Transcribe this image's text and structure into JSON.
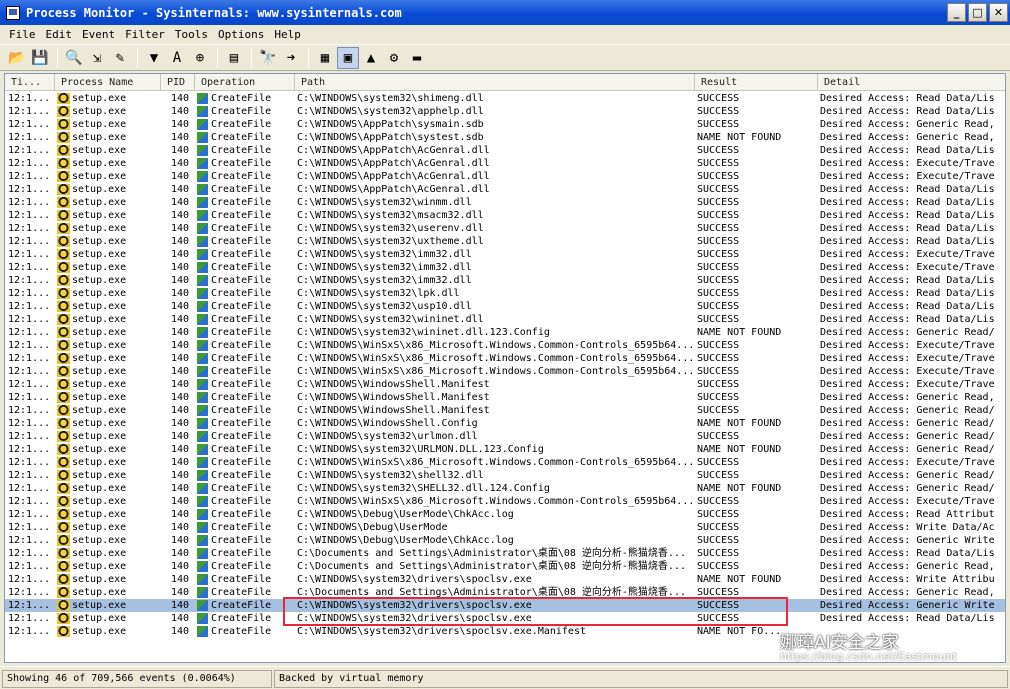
{
  "window": {
    "title": "Process Monitor - Sysinternals: www.sysinternals.com"
  },
  "menu": [
    "File",
    "Edit",
    "Event",
    "Filter",
    "Tools",
    "Options",
    "Help"
  ],
  "toolbar": [
    {
      "icon": "open-icon",
      "glyph": "📂"
    },
    {
      "icon": "save-icon",
      "glyph": "💾"
    },
    {
      "icon": "capture-icon",
      "glyph": "🔍"
    },
    {
      "icon": "autoscroll-icon",
      "glyph": "⇲"
    },
    {
      "icon": "clear-icon",
      "glyph": "✎"
    },
    {
      "icon": "filter-icon",
      "glyph": "▼"
    },
    {
      "icon": "highlight-icon",
      "glyph": "A"
    },
    {
      "icon": "network-target-icon",
      "glyph": "⊕"
    },
    {
      "icon": "process-tree-icon",
      "glyph": "▤"
    },
    {
      "icon": "find-icon",
      "glyph": "🔭"
    },
    {
      "icon": "jump-icon",
      "glyph": "➜"
    },
    {
      "icon": "registry-icon",
      "glyph": "▦"
    },
    {
      "icon": "filesystem-icon",
      "glyph": "▣"
    },
    {
      "icon": "network-icon",
      "glyph": "▲"
    },
    {
      "icon": "process-thread-icon",
      "glyph": "⚙"
    },
    {
      "icon": "profiling-icon",
      "glyph": "▬"
    }
  ],
  "columns": {
    "time": "Ti...",
    "process": "Process Name",
    "pid": "PID",
    "operation": "Operation",
    "path": "Path",
    "result": "Result",
    "detail": "Detail"
  },
  "rows": [
    {
      "time": "12:1...",
      "process": "setup.exe",
      "pid": "140",
      "op": "CreateFile",
      "path": "C:\\WINDOWS\\system32\\shimeng.dll",
      "result": "SUCCESS",
      "detail": "Desired Access: Read Data/Lis"
    },
    {
      "time": "12:1...",
      "process": "setup.exe",
      "pid": "140",
      "op": "CreateFile",
      "path": "C:\\WINDOWS\\system32\\apphelp.dll",
      "result": "SUCCESS",
      "detail": "Desired Access: Read Data/Lis"
    },
    {
      "time": "12:1...",
      "process": "setup.exe",
      "pid": "140",
      "op": "CreateFile",
      "path": "C:\\WINDOWS\\AppPatch\\sysmain.sdb",
      "result": "SUCCESS",
      "detail": "Desired Access: Generic Read,"
    },
    {
      "time": "12:1...",
      "process": "setup.exe",
      "pid": "140",
      "op": "CreateFile",
      "path": "C:\\WINDOWS\\AppPatch\\systest.sdb",
      "result": "NAME NOT FOUND",
      "detail": "Desired Access: Generic Read,"
    },
    {
      "time": "12:1...",
      "process": "setup.exe",
      "pid": "140",
      "op": "CreateFile",
      "path": "C:\\WINDOWS\\AppPatch\\AcGenral.dll",
      "result": "SUCCESS",
      "detail": "Desired Access: Read Data/Lis"
    },
    {
      "time": "12:1...",
      "process": "setup.exe",
      "pid": "140",
      "op": "CreateFile",
      "path": "C:\\WINDOWS\\AppPatch\\AcGenral.dll",
      "result": "SUCCESS",
      "detail": "Desired Access: Execute/Trave"
    },
    {
      "time": "12:1...",
      "process": "setup.exe",
      "pid": "140",
      "op": "CreateFile",
      "path": "C:\\WINDOWS\\AppPatch\\AcGenral.dll",
      "result": "SUCCESS",
      "detail": "Desired Access: Execute/Trave"
    },
    {
      "time": "12:1...",
      "process": "setup.exe",
      "pid": "140",
      "op": "CreateFile",
      "path": "C:\\WINDOWS\\AppPatch\\AcGenral.dll",
      "result": "SUCCESS",
      "detail": "Desired Access: Read Data/Lis"
    },
    {
      "time": "12:1...",
      "process": "setup.exe",
      "pid": "140",
      "op": "CreateFile",
      "path": "C:\\WINDOWS\\system32\\winmm.dll",
      "result": "SUCCESS",
      "detail": "Desired Access: Read Data/Lis"
    },
    {
      "time": "12:1...",
      "process": "setup.exe",
      "pid": "140",
      "op": "CreateFile",
      "path": "C:\\WINDOWS\\system32\\msacm32.dll",
      "result": "SUCCESS",
      "detail": "Desired Access: Read Data/Lis"
    },
    {
      "time": "12:1...",
      "process": "setup.exe",
      "pid": "140",
      "op": "CreateFile",
      "path": "C:\\WINDOWS\\system32\\userenv.dll",
      "result": "SUCCESS",
      "detail": "Desired Access: Read Data/Lis"
    },
    {
      "time": "12:1...",
      "process": "setup.exe",
      "pid": "140",
      "op": "CreateFile",
      "path": "C:\\WINDOWS\\system32\\uxtheme.dll",
      "result": "SUCCESS",
      "detail": "Desired Access: Read Data/Lis"
    },
    {
      "time": "12:1...",
      "process": "setup.exe",
      "pid": "140",
      "op": "CreateFile",
      "path": "C:\\WINDOWS\\system32\\imm32.dll",
      "result": "SUCCESS",
      "detail": "Desired Access: Execute/Trave"
    },
    {
      "time": "12:1...",
      "process": "setup.exe",
      "pid": "140",
      "op": "CreateFile",
      "path": "C:\\WINDOWS\\system32\\imm32.dll",
      "result": "SUCCESS",
      "detail": "Desired Access: Execute/Trave"
    },
    {
      "time": "12:1...",
      "process": "setup.exe",
      "pid": "140",
      "op": "CreateFile",
      "path": "C:\\WINDOWS\\system32\\imm32.dll",
      "result": "SUCCESS",
      "detail": "Desired Access: Read Data/Lis"
    },
    {
      "time": "12:1...",
      "process": "setup.exe",
      "pid": "140",
      "op": "CreateFile",
      "path": "C:\\WINDOWS\\system32\\lpk.dll",
      "result": "SUCCESS",
      "detail": "Desired Access: Read Data/Lis"
    },
    {
      "time": "12:1...",
      "process": "setup.exe",
      "pid": "140",
      "op": "CreateFile",
      "path": "C:\\WINDOWS\\system32\\usp10.dll",
      "result": "SUCCESS",
      "detail": "Desired Access: Read Data/Lis"
    },
    {
      "time": "12:1...",
      "process": "setup.exe",
      "pid": "140",
      "op": "CreateFile",
      "path": "C:\\WINDOWS\\system32\\wininet.dll",
      "result": "SUCCESS",
      "detail": "Desired Access: Read Data/Lis"
    },
    {
      "time": "12:1...",
      "process": "setup.exe",
      "pid": "140",
      "op": "CreateFile",
      "path": "C:\\WINDOWS\\system32\\wininet.dll.123.Config",
      "result": "NAME NOT FOUND",
      "detail": "Desired Access: Generic Read/"
    },
    {
      "time": "12:1...",
      "process": "setup.exe",
      "pid": "140",
      "op": "CreateFile",
      "path": "C:\\WINDOWS\\WinSxS\\x86_Microsoft.Windows.Common-Controls_6595b64...",
      "result": "SUCCESS",
      "detail": "Desired Access: Execute/Trave"
    },
    {
      "time": "12:1...",
      "process": "setup.exe",
      "pid": "140",
      "op": "CreateFile",
      "path": "C:\\WINDOWS\\WinSxS\\x86_Microsoft.Windows.Common-Controls_6595b64...",
      "result": "SUCCESS",
      "detail": "Desired Access: Execute/Trave"
    },
    {
      "time": "12:1...",
      "process": "setup.exe",
      "pid": "140",
      "op": "CreateFile",
      "path": "C:\\WINDOWS\\WinSxS\\x86_Microsoft.Windows.Common-Controls_6595b64...",
      "result": "SUCCESS",
      "detail": "Desired Access: Execute/Trave"
    },
    {
      "time": "12:1...",
      "process": "setup.exe",
      "pid": "140",
      "op": "CreateFile",
      "path": "C:\\WINDOWS\\WindowsShell.Manifest",
      "result": "SUCCESS",
      "detail": "Desired Access: Execute/Trave"
    },
    {
      "time": "12:1...",
      "process": "setup.exe",
      "pid": "140",
      "op": "CreateFile",
      "path": "C:\\WINDOWS\\WindowsShell.Manifest",
      "result": "SUCCESS",
      "detail": "Desired Access: Generic Read,"
    },
    {
      "time": "12:1...",
      "process": "setup.exe",
      "pid": "140",
      "op": "CreateFile",
      "path": "C:\\WINDOWS\\WindowsShell.Manifest",
      "result": "SUCCESS",
      "detail": "Desired Access: Generic Read/"
    },
    {
      "time": "12:1...",
      "process": "setup.exe",
      "pid": "140",
      "op": "CreateFile",
      "path": "C:\\WINDOWS\\WindowsShell.Config",
      "result": "NAME NOT FOUND",
      "detail": "Desired Access: Generic Read/"
    },
    {
      "time": "12:1...",
      "process": "setup.exe",
      "pid": "140",
      "op": "CreateFile",
      "path": "C:\\WINDOWS\\system32\\urlmon.dll",
      "result": "SUCCESS",
      "detail": "Desired Access: Generic Read/"
    },
    {
      "time": "12:1...",
      "process": "setup.exe",
      "pid": "140",
      "op": "CreateFile",
      "path": "C:\\WINDOWS\\system32\\URLMON.DLL.123.Config",
      "result": "NAME NOT FOUND",
      "detail": "Desired Access: Generic Read/"
    },
    {
      "time": "12:1...",
      "process": "setup.exe",
      "pid": "140",
      "op": "CreateFile",
      "path": "C:\\WINDOWS\\WinSxS\\x86_Microsoft.Windows.Common-Controls_6595b64...",
      "result": "SUCCESS",
      "detail": "Desired Access: Execute/Trave"
    },
    {
      "time": "12:1...",
      "process": "setup.exe",
      "pid": "140",
      "op": "CreateFile",
      "path": "C:\\WINDOWS\\system32\\shell32.dll",
      "result": "SUCCESS",
      "detail": "Desired Access: Generic Read/"
    },
    {
      "time": "12:1...",
      "process": "setup.exe",
      "pid": "140",
      "op": "CreateFile",
      "path": "C:\\WINDOWS\\system32\\SHELL32.dll.124.Config",
      "result": "NAME NOT FOUND",
      "detail": "Desired Access: Generic Read/"
    },
    {
      "time": "12:1...",
      "process": "setup.exe",
      "pid": "140",
      "op": "CreateFile",
      "path": "C:\\WINDOWS\\WinSxS\\x86_Microsoft.Windows.Common-Controls_6595b64...",
      "result": "SUCCESS",
      "detail": "Desired Access: Execute/Trave"
    },
    {
      "time": "12:1...",
      "process": "setup.exe",
      "pid": "140",
      "op": "CreateFile",
      "path": "C:\\WINDOWS\\Debug\\UserMode\\ChkAcc.log",
      "result": "SUCCESS",
      "detail": "Desired Access: Read Attribut"
    },
    {
      "time": "12:1...",
      "process": "setup.exe",
      "pid": "140",
      "op": "CreateFile",
      "path": "C:\\WINDOWS\\Debug\\UserMode",
      "result": "SUCCESS",
      "detail": "Desired Access: Write Data/Ac"
    },
    {
      "time": "12:1...",
      "process": "setup.exe",
      "pid": "140",
      "op": "CreateFile",
      "path": "C:\\WINDOWS\\Debug\\UserMode\\ChkAcc.log",
      "result": "SUCCESS",
      "detail": "Desired Access: Generic Write"
    },
    {
      "time": "12:1...",
      "process": "setup.exe",
      "pid": "140",
      "op": "CreateFile",
      "path": "C:\\Documents and Settings\\Administrator\\桌面\\08 逆向分析-熊猫烧香...",
      "result": "SUCCESS",
      "detail": "Desired Access: Read Data/Lis"
    },
    {
      "time": "12:1...",
      "process": "setup.exe",
      "pid": "140",
      "op": "CreateFile",
      "path": "C:\\Documents and Settings\\Administrator\\桌面\\08 逆向分析-熊猫烧香...",
      "result": "SUCCESS",
      "detail": "Desired Access: Generic Read,"
    },
    {
      "time": "12:1...",
      "process": "setup.exe",
      "pid": "140",
      "op": "CreateFile",
      "path": "C:\\WINDOWS\\system32\\drivers\\spoclsv.exe",
      "result": "NAME NOT FOUND",
      "detail": "Desired Access: Write Attribu"
    },
    {
      "time": "12:1...",
      "process": "setup.exe",
      "pid": "140",
      "op": "CreateFile",
      "path": "C:\\Documents and Settings\\Administrator\\桌面\\08 逆向分析-熊猫烧香...",
      "result": "SUCCESS",
      "detail": "Desired Access: Generic Read,"
    },
    {
      "time": "12:1...",
      "process": "setup.exe",
      "pid": "140",
      "op": "CreateFile",
      "path": "C:\\WINDOWS\\system32\\drivers\\spoclsv.exe",
      "result": "SUCCESS",
      "detail": "Desired Access: Generic Write",
      "selected": true
    },
    {
      "time": "12:1...",
      "process": "setup.exe",
      "pid": "140",
      "op": "CreateFile",
      "path": "C:\\WINDOWS\\system32\\drivers\\spoclsv.exe",
      "result": "SUCCESS",
      "detail": "Desired Access: Read Data/Lis"
    },
    {
      "time": "12:1...",
      "process": "setup.exe",
      "pid": "140",
      "op": "CreateFile",
      "path": "C:\\WINDOWS\\system32\\drivers\\spoclsv.exe.Manifest",
      "result": "NAME NOT FO...",
      "detail": ""
    }
  ],
  "status": {
    "events": "Showing 46 of 709,566 events (0.0064%)",
    "memory": "Backed by virtual memory"
  },
  "watermark": {
    "line1": "娜璋AI安全之家",
    "line2": "https://blog.csdn.net/Eastmount"
  },
  "colors": {
    "title_bar": "#0a4bd6",
    "selection": "#a8c0e0",
    "highlight_box": "#e8283a"
  }
}
